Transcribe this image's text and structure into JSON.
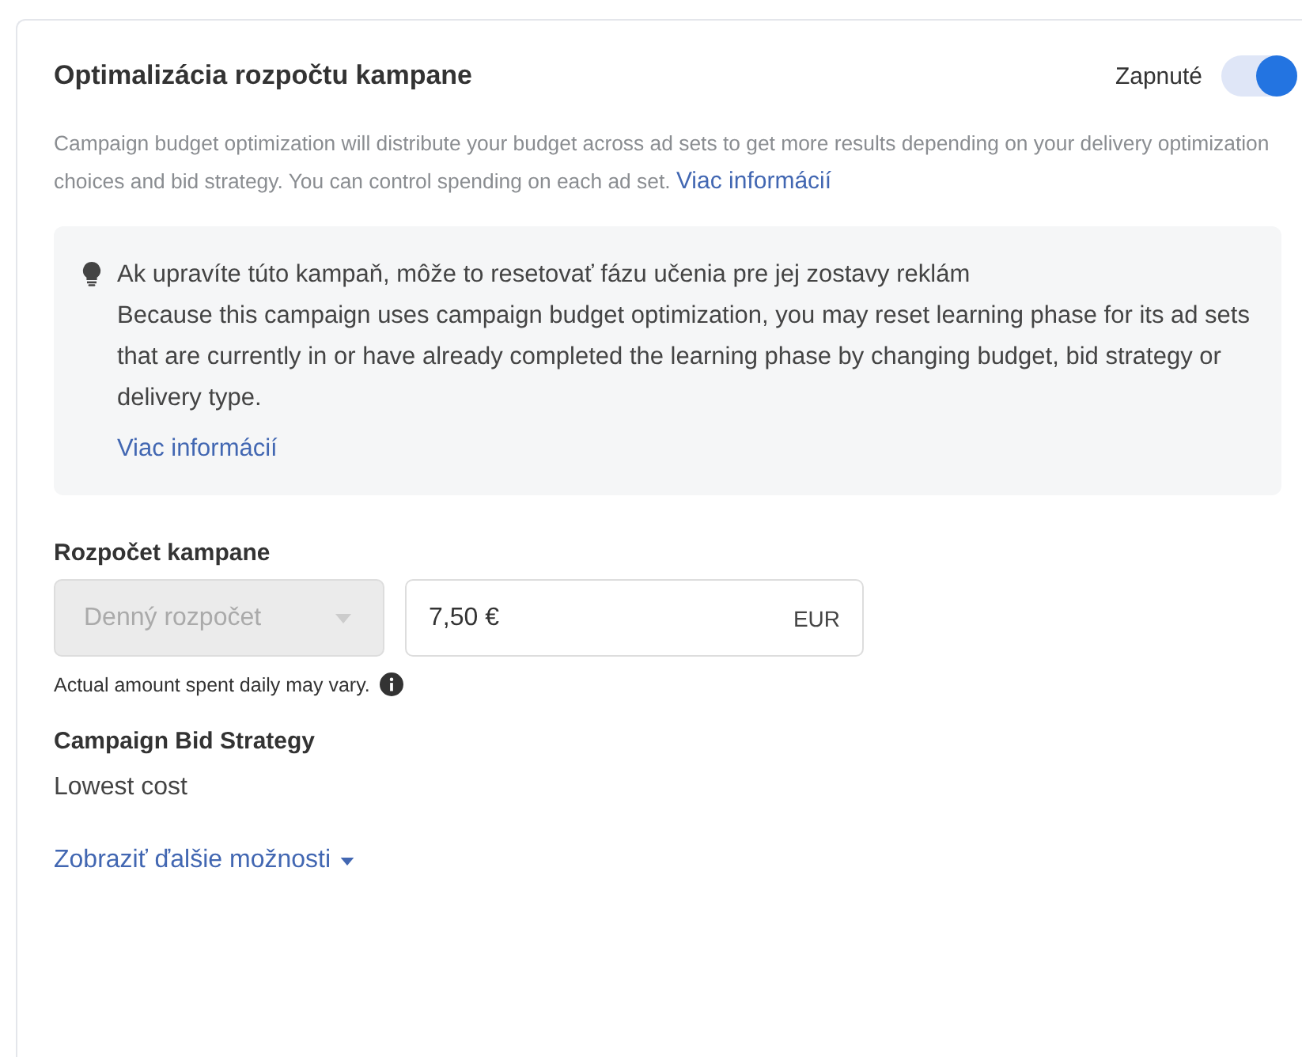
{
  "header": {
    "title": "Optimalizácia rozpočtu kampane",
    "toggle_label": "Zapnuté",
    "toggle_on": true
  },
  "description": {
    "text": "Campaign budget optimization will distribute your budget across ad sets to get more results depending on your delivery optimization choices and bid strategy. You can control spending on each ad set.",
    "link": "Viac informácií"
  },
  "notice": {
    "title": "Ak upravíte túto kampaň, môže to resetovať fázu učenia pre jej zostavy reklám",
    "text": "Because this campaign uses campaign budget optimization, you may reset learning phase for its ad sets that are currently in or have already completed the learning phase by changing budget, bid strategy or delivery type.",
    "link": "Viac informácií"
  },
  "budget": {
    "label": "Rozpočet kampane",
    "type_select": {
      "value": "Denný rozpočet",
      "disabled": true
    },
    "amount": {
      "value": "7,50 €",
      "currency": "EUR"
    },
    "hint": "Actual amount spent daily may vary."
  },
  "bid_strategy": {
    "label": "Campaign Bid Strategy",
    "value": "Lowest cost"
  },
  "more_options": "Zobraziť ďalšie možnosti"
}
